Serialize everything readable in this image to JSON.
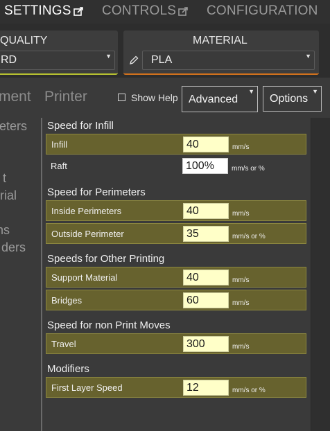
{
  "top_tabs": {
    "settings": "SETTINGS",
    "controls": "CONTROLS",
    "configuration": "CONFIGURATION"
  },
  "quality": {
    "title": "QUALITY",
    "value": "RD"
  },
  "material": {
    "title": "MATERIAL",
    "value": "PLA"
  },
  "sub_tabs": {
    "left": "ment",
    "printer": "Printer"
  },
  "show_help": "Show Help",
  "mode_select": "Advanced",
  "options_button": "Options",
  "sidebar": [
    "eters",
    "t",
    "rial",
    "ns",
    "ders"
  ],
  "groups": [
    {
      "title": "Speed for Infill",
      "rows": [
        {
          "label": "Infill",
          "value": "40",
          "unit": "mm/s"
        },
        {
          "label": "Raft",
          "value": "100%",
          "unit": "mm/s or %"
        }
      ]
    },
    {
      "title": "Speed for Perimeters",
      "rows": [
        {
          "label": "Inside Perimeters",
          "value": "40",
          "unit": "mm/s"
        },
        {
          "label": "Outside Perimeter",
          "value": "35",
          "unit": "mm/s or %"
        }
      ]
    },
    {
      "title": "Speeds for Other Printing",
      "rows": [
        {
          "label": "Support Material",
          "value": "40",
          "unit": "mm/s"
        },
        {
          "label": "Bridges",
          "value": "60",
          "unit": "mm/s"
        }
      ]
    },
    {
      "title": "Speed for non Print Moves",
      "rows": [
        {
          "label": "Travel",
          "value": "300",
          "unit": "mm/s"
        }
      ]
    },
    {
      "title": "Modifiers",
      "rows": [
        {
          "label": "First Layer Speed",
          "value": "12",
          "unit": "mm/s or %"
        }
      ]
    }
  ],
  "colors": {
    "quality_accent": "#b8c230",
    "material_accent": "#d4721c",
    "highlight_row": "#67622e",
    "value_bg": "#ffffc8"
  },
  "icons": [
    "external-link-icon",
    "pencil-icon",
    "dropdown-arrow-icon",
    "checkbox-icon"
  ]
}
